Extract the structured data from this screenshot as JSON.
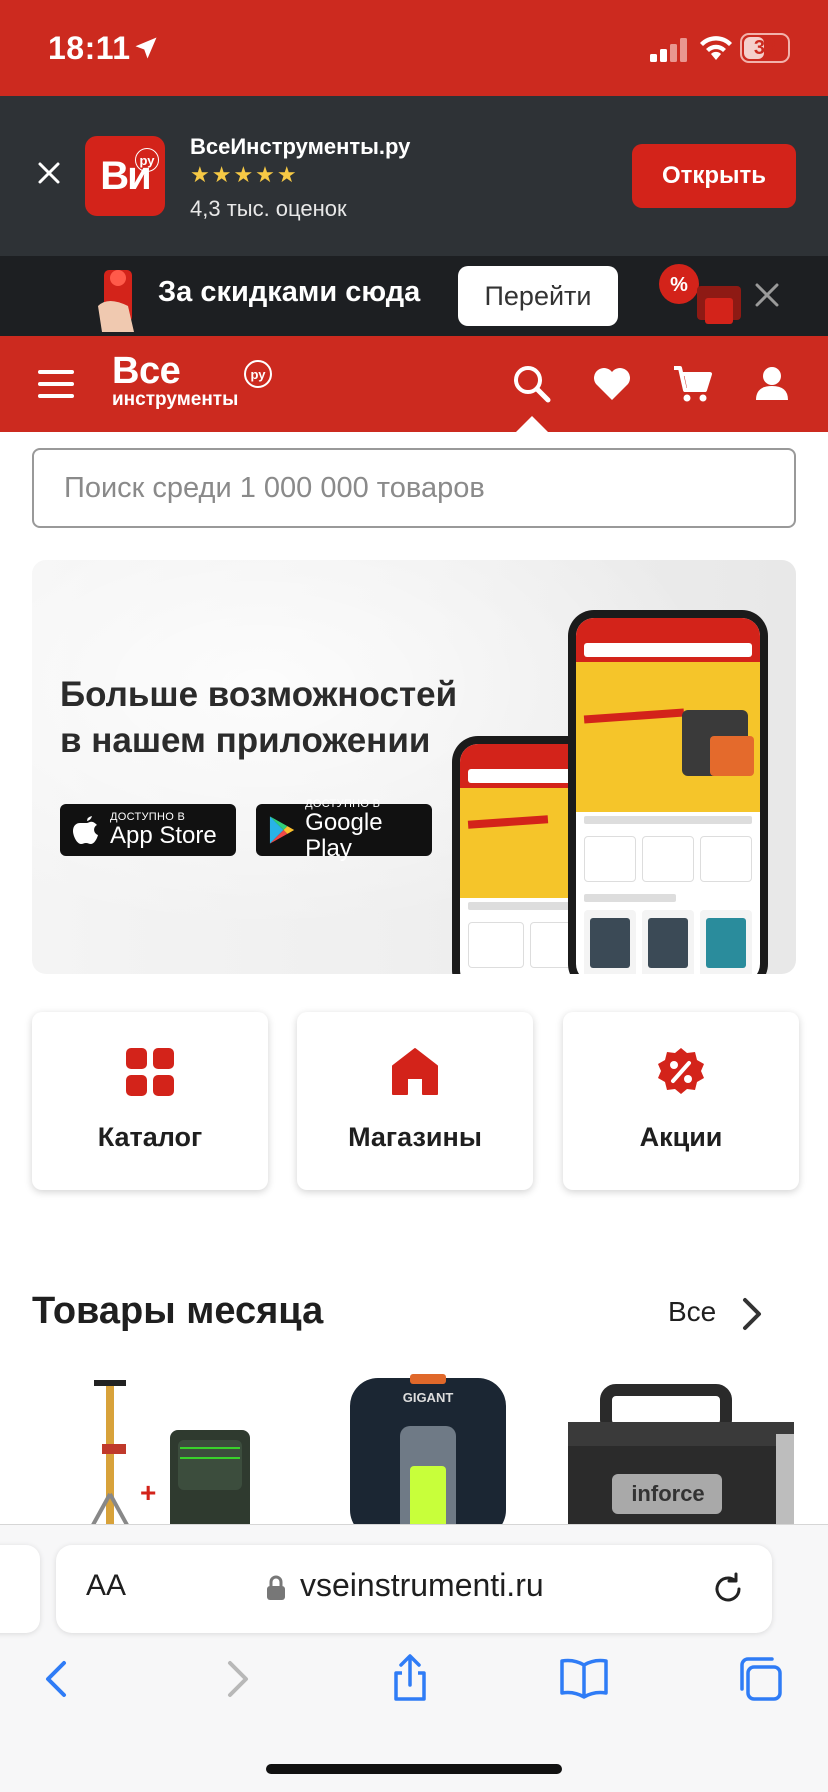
{
  "status_bar": {
    "time": "18:11",
    "battery": "33"
  },
  "app_banner": {
    "app_name": "ВсеИнструменты.ру",
    "logo_text": "Ви",
    "logo_badge": "ру",
    "stars": "★★★★★",
    "rating_count": "4,3 тыс. оценок",
    "open_label": "Открыть"
  },
  "promo": {
    "text": "За скидками сюда",
    "button_label": "Перейти"
  },
  "header": {
    "logo_main": "Все",
    "logo_sub": "инструменты",
    "logo_ru": "ру"
  },
  "search": {
    "placeholder": "Поиск среди 1 000 000 товаров"
  },
  "hero": {
    "title_line1": "Больше возможностей",
    "title_line2": "в нашем приложении",
    "appstore_small": "ДОСТУПНО В",
    "appstore_big": "App Store",
    "googleplay_small": "ДОСТУПНО В",
    "googleplay_big": "Google Play"
  },
  "tiles": [
    {
      "label": "Каталог",
      "icon": "grid-icon"
    },
    {
      "label": "Магазины",
      "icon": "store-icon"
    },
    {
      "label": "Акции",
      "icon": "discount-icon"
    }
  ],
  "section": {
    "title": "Товары месяца",
    "all_label": "Все"
  },
  "products": [
    {
      "icon": "laser-level-icon"
    },
    {
      "icon": "work-lamp-icon"
    },
    {
      "icon": "toolbox-icon"
    }
  ],
  "safari": {
    "aa": "AA",
    "url": "vseinstrumenti.ru"
  },
  "colors": {
    "brand_red": "#cc2a1f",
    "dark_banner": "#2e3236",
    "accent_yellow": "#f5c52a"
  }
}
